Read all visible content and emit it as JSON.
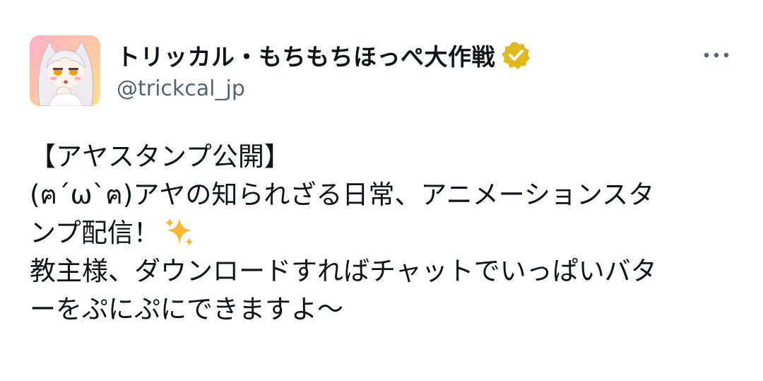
{
  "author": {
    "display_name": "トリッカル・もちもちほっぺ大作戦",
    "handle": "@trickcal_jp",
    "verified_badge_color": "#e2b719",
    "avatar_icon": "anime-character-avatar-icon"
  },
  "menu": {
    "more_icon": "more-options-icon"
  },
  "tweet": {
    "lines": [
      "【アヤスタンプ公開】",
      "(ฅ´ω`ฅ)アヤの知られざる日常、アニメーションスタ",
      "ンプ配信！",
      "教主様、ダウンロードすればチャットでいっぱいバタ",
      "ーをぷにぷにできますよ～"
    ],
    "emoji_after_line_3": "sparkles-icon"
  },
  "colors": {
    "text_primary": "#0f1419",
    "text_secondary": "#536471",
    "sparkle": "#f5b82e"
  }
}
